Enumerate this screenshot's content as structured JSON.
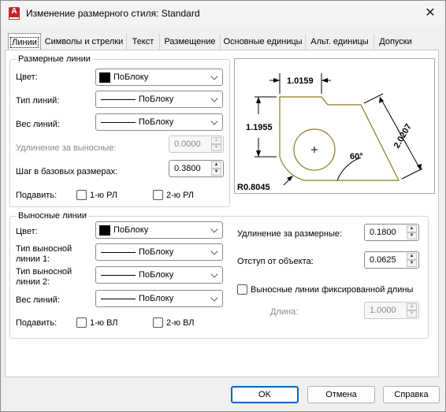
{
  "window": {
    "title": "Изменение размерного стиля: Standard",
    "app_icon_letter": "A",
    "close_glyph": "✕"
  },
  "tabs": [
    {
      "label": "Линии",
      "active": true
    },
    {
      "label": "Символы и стрелки"
    },
    {
      "label": "Текст"
    },
    {
      "label": "Размещение"
    },
    {
      "label": "Основные единицы"
    },
    {
      "label": "Альт. единицы"
    },
    {
      "label": "Допуски"
    }
  ],
  "dim_lines": {
    "group_title": "Размерные линии",
    "color_label": "Цвет:",
    "color_value": "ПоБлоку",
    "linetype_label": "Тип линий:",
    "linetype_value": "ПоБлоку",
    "lineweight_label": "Вес линий:",
    "lineweight_value": "ПоБлоку",
    "extend_label": "Удлинение за выносные:",
    "extend_value": "0.0000",
    "baseline_label": "Шаг в базовых размерах:",
    "baseline_value": "0.3800",
    "suppress_label": "Подавить:",
    "suppress1": "1-ю РЛ",
    "suppress2": "2-ю РЛ"
  },
  "ext_lines": {
    "group_title": "Выносные линии",
    "color_label": "Цвет:",
    "color_value": "ПоБлоку",
    "linetype1_label_a": "Тип выносной",
    "linetype1_label_b": "линии 1:",
    "linetype1_value": "ПоБлоку",
    "linetype2_label_a": "Тип выносной",
    "linetype2_label_b": "линии 2:",
    "linetype2_value": "ПоБлоку",
    "lineweight_label": "Вес линий:",
    "lineweight_value": "ПоБлоку",
    "suppress_label": "Подавить:",
    "suppress1": "1-ю ВЛ",
    "suppress2": "2-ю ВЛ",
    "extend_label": "Удлинение за размерные:",
    "extend_value": "0.1800",
    "offset_label": "Отступ от объекта:",
    "offset_value": "0.0625",
    "fixed_label": "Выносные линии фиксированной длины",
    "length_label": "Длина:",
    "length_value": "1.0000"
  },
  "preview": {
    "dim_top": "1.0159",
    "dim_left": "1.1955",
    "dim_right": "2.0207",
    "dim_angle": "60°",
    "dim_radius": "R0.8045",
    "shape_color": "#8b7a1f"
  },
  "buttons": {
    "ok": "OK",
    "cancel": "Отмена",
    "help": "Справка"
  },
  "colors": {
    "accent": "#0067c0",
    "app_icon": "#c4262e"
  }
}
